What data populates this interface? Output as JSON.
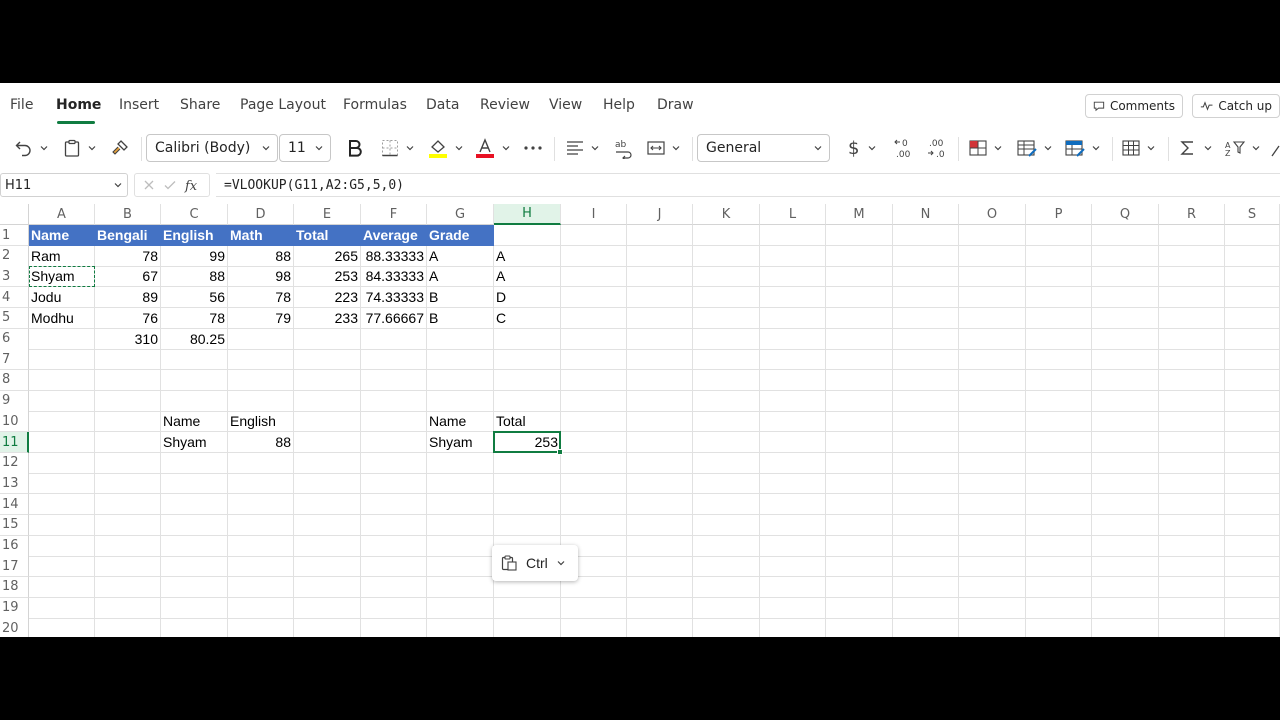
{
  "menu": {
    "tabs": [
      "File",
      "Home",
      "Insert",
      "Share",
      "Page Layout",
      "Formulas",
      "Data",
      "Review",
      "View",
      "Help",
      "Draw"
    ],
    "active_tab": "Home",
    "comments_label": "Comments",
    "catchup_label": "Catch up"
  },
  "ribbon": {
    "font_name": "Calibri (Body)",
    "font_size": "11",
    "number_format": "General",
    "highlight_color": "#ffff00",
    "font_color": "#e81123"
  },
  "formula_bar": {
    "name_box": "H11",
    "formula": "=VLOOKUP(G11,A2:G5,5,0)"
  },
  "grid": {
    "columns": [
      "A",
      "B",
      "C",
      "D",
      "E",
      "F",
      "G",
      "H",
      "I",
      "J",
      "K",
      "L",
      "M",
      "N",
      "O",
      "P",
      "Q",
      "R",
      "S"
    ],
    "rows": [
      "1",
      "2",
      "3",
      "4",
      "5",
      "6",
      "7",
      "8",
      "9",
      "10",
      "11",
      "12",
      "13",
      "14",
      "15",
      "16",
      "17",
      "18",
      "19",
      "20"
    ],
    "selected_column": "H",
    "selected_row": "11",
    "header_fill": "#4472c4",
    "accent_color": "#107c41",
    "cells": {
      "A1": "Name",
      "B1": "Bengali",
      "C1": "English",
      "D1": "Math",
      "E1": "Total",
      "F1": "Average",
      "G1": "Grade",
      "A2": "Ram",
      "B2": "78",
      "C2": "99",
      "D2": "88",
      "E2": "265",
      "F2": "88.33333",
      "G2": "A",
      "H2": "A",
      "A3": "Shyam",
      "B3": "67",
      "C3": "88",
      "D3": "98",
      "E3": "253",
      "F3": "84.33333",
      "G3": "A",
      "H3": "A",
      "A4": "Jodu",
      "B4": "89",
      "C4": "56",
      "D4": "78",
      "E4": "223",
      "F4": "74.33333",
      "G4": "B",
      "H4": "D",
      "A5": "Modhu",
      "B5": "76",
      "C5": "78",
      "D5": "79",
      "E5": "233",
      "F5": "77.66667",
      "G5": "B",
      "H5": "C",
      "B6": "310",
      "C6": "80.25",
      "C10": "Name",
      "D10": "English",
      "G10": "Name",
      "H10": "Total",
      "C11": "Shyam",
      "D11": "88",
      "G11": "Shyam",
      "H11": "253"
    }
  },
  "paste_popup": {
    "label": "Ctrl"
  }
}
